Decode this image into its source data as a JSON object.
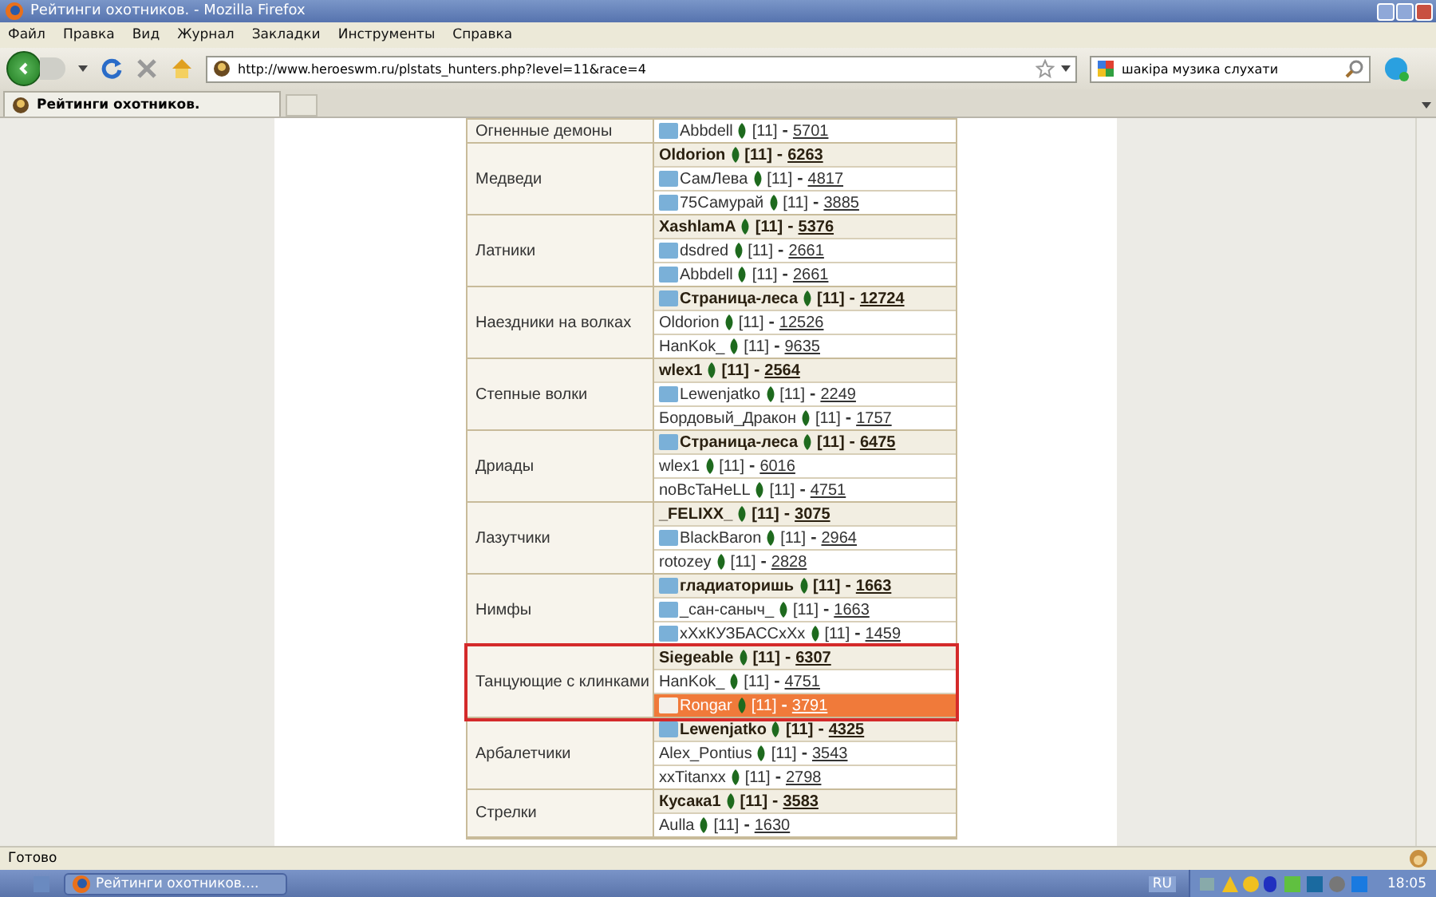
{
  "window": {
    "title": "Рейтинги охотников. - Mozilla Firefox"
  },
  "menu": [
    "Файл",
    "Правка",
    "Вид",
    "Журнал",
    "Закладки",
    "Инструменты",
    "Справка"
  ],
  "address_bar": {
    "value": "http://www.heroeswm.ru/plstats_hunters.php?level=11&race=4"
  },
  "search": {
    "value": "шакіра музика слухати"
  },
  "tabs": [
    {
      "label": "Рейтинги охотников.",
      "selected": true
    }
  ],
  "groups": [
    {
      "name": "Огненные демоны",
      "outlined": false,
      "rows": [
        {
          "player": "Abbdell",
          "level": "[11]",
          "separator": "-",
          "score": "5701",
          "avatar": true,
          "leader": false,
          "highlighted": false
        }
      ]
    },
    {
      "name": "Медведи",
      "outlined": false,
      "rows": [
        {
          "player": "Oldorion",
          "level": "[11]",
          "separator": "-",
          "score": "6263",
          "avatar": false,
          "leader": true,
          "highlighted": false
        },
        {
          "player": "СамЛева",
          "level": "[11]",
          "separator": "-",
          "score": "4817",
          "avatar": true,
          "leader": false,
          "highlighted": false
        },
        {
          "player": "75Самурай",
          "level": "[11]",
          "separator": "-",
          "score": "3885",
          "avatar": true,
          "leader": false,
          "highlighted": false
        }
      ]
    },
    {
      "name": "Латники",
      "outlined": false,
      "rows": [
        {
          "player": "XashlamA",
          "level": "[11]",
          "separator": "-",
          "score": "5376",
          "avatar": false,
          "leader": true,
          "highlighted": false
        },
        {
          "player": "dsdred",
          "level": "[11]",
          "separator": "-",
          "score": "2661",
          "avatar": true,
          "leader": false,
          "highlighted": false
        },
        {
          "player": "Abbdell",
          "level": "[11]",
          "separator": "-",
          "score": "2661",
          "avatar": true,
          "leader": false,
          "highlighted": false
        }
      ]
    },
    {
      "name": "Наездники на волках",
      "outlined": false,
      "rows": [
        {
          "player": "Страница-леса",
          "level": "[11]",
          "separator": "-",
          "score": "12724",
          "avatar": true,
          "leader": true,
          "highlighted": false
        },
        {
          "player": "Oldorion",
          "level": "[11]",
          "separator": "-",
          "score": "12526",
          "avatar": false,
          "leader": false,
          "highlighted": false
        },
        {
          "player": "HanKok_",
          "level": "[11]",
          "separator": "-",
          "score": "9635",
          "avatar": false,
          "leader": false,
          "highlighted": false
        }
      ]
    },
    {
      "name": "Степные волки",
      "outlined": false,
      "rows": [
        {
          "player": "wlex1",
          "level": "[11]",
          "separator": "-",
          "score": "2564",
          "avatar": false,
          "leader": true,
          "highlighted": false
        },
        {
          "player": "Lewenjatko",
          "level": "[11]",
          "separator": "-",
          "score": "2249",
          "avatar": true,
          "leader": false,
          "highlighted": false
        },
        {
          "player": "Бордовый_Дракон",
          "level": "[11]",
          "separator": "-",
          "score": "1757",
          "avatar": false,
          "leader": false,
          "highlighted": false
        }
      ]
    },
    {
      "name": "Дриады",
      "outlined": false,
      "rows": [
        {
          "player": "Страница-леса",
          "level": "[11]",
          "separator": "-",
          "score": "6475",
          "avatar": true,
          "leader": true,
          "highlighted": false
        },
        {
          "player": "wlex1",
          "level": "[11]",
          "separator": "-",
          "score": "6016",
          "avatar": false,
          "leader": false,
          "highlighted": false
        },
        {
          "player": "noBcTaHeLL",
          "level": "[11]",
          "separator": "-",
          "score": "4751",
          "avatar": false,
          "leader": false,
          "highlighted": false
        }
      ]
    },
    {
      "name": "Лазутчики",
      "outlined": false,
      "rows": [
        {
          "player": "_FELIXX_",
          "level": "[11]",
          "separator": "-",
          "score": "3075",
          "avatar": false,
          "leader": true,
          "highlighted": false
        },
        {
          "player": "BlackBaron",
          "level": "[11]",
          "separator": "-",
          "score": "2964",
          "avatar": true,
          "leader": false,
          "highlighted": false
        },
        {
          "player": "rotozey",
          "level": "[11]",
          "separator": "-",
          "score": "2828",
          "avatar": false,
          "leader": false,
          "highlighted": false
        }
      ]
    },
    {
      "name": "Нимфы",
      "outlined": false,
      "rows": [
        {
          "player": "гладиаторишь",
          "level": "[11]",
          "separator": "-",
          "score": "1663",
          "avatar": true,
          "leader": true,
          "highlighted": false
        },
        {
          "player": "_сан-саныч_",
          "level": "[11]",
          "separator": "-",
          "score": "1663",
          "avatar": true,
          "leader": false,
          "highlighted": false
        },
        {
          "player": "xXxКУЗБАССxXx",
          "level": "[11]",
          "separator": "-",
          "score": "1459",
          "avatar": true,
          "leader": false,
          "highlighted": false
        }
      ]
    },
    {
      "name": "Танцующие с клинками",
      "outlined": true,
      "rows": [
        {
          "player": "Siegeable",
          "level": "[11]",
          "separator": "-",
          "score": "6307",
          "avatar": false,
          "leader": true,
          "highlighted": false
        },
        {
          "player": "HanKok_",
          "level": "[11]",
          "separator": "-",
          "score": "4751",
          "avatar": false,
          "leader": false,
          "highlighted": false
        },
        {
          "player": "Rongar",
          "level": "[11]",
          "separator": "-",
          "score": "3791",
          "avatar": true,
          "leader": false,
          "highlighted": true
        }
      ]
    },
    {
      "name": "Арбалетчики",
      "outlined": false,
      "rows": [
        {
          "player": "Lewenjatko",
          "level": "[11]",
          "separator": "-",
          "score": "4325",
          "avatar": true,
          "leader": true,
          "highlighted": false
        },
        {
          "player": "Alex_Pontius",
          "level": "[11]",
          "separator": "-",
          "score": "3543",
          "avatar": false,
          "leader": false,
          "highlighted": false
        },
        {
          "player": "xxTitanxx",
          "level": "[11]",
          "separator": "-",
          "score": "2798",
          "avatar": false,
          "leader": false,
          "highlighted": false
        }
      ]
    },
    {
      "name": "Стрелки",
      "outlined": false,
      "rows": [
        {
          "player": "Кусака1",
          "level": "[11]",
          "separator": "-",
          "score": "3583",
          "avatar": false,
          "leader": true,
          "highlighted": false
        },
        {
          "player": "Aulla",
          "level": "[11]",
          "separator": "-",
          "score": "1630",
          "avatar": false,
          "leader": false,
          "highlighted": false
        }
      ]
    }
  ],
  "status_bar": {
    "text": "Готово"
  },
  "taskbar": {
    "task": "Рейтинги охотников....",
    "language": "RU",
    "time": "18:05"
  }
}
